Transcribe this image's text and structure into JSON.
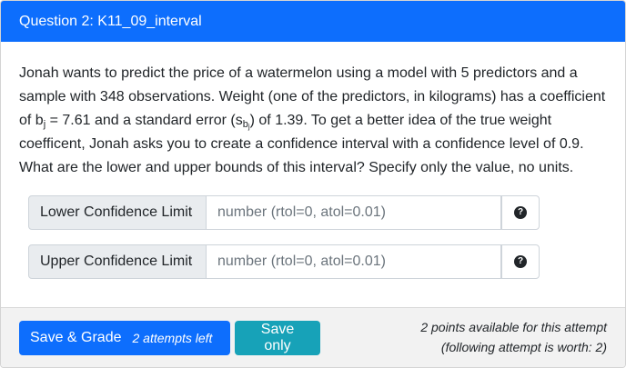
{
  "header": {
    "title": "Question 2: K11_09_interval"
  },
  "question": {
    "part1": "Jonah wants to predict the price of a watermelon using a model with 5 predictors and a sample with 348 observations. Weight (one of the predictors, in kilograms) has a coefficient of b",
    "sub_j": "j",
    "part2": " = 7.61 and a standard error (s",
    "sub_b": "b",
    "subsub_j": "j",
    "part3": ") of 1.39. To get a better idea of the true weight coefficent, Jonah asks you to create a confidence interval with a confidence level of 0.9. What are the lower and upper bounds of this interval? Specify only the value, no units."
  },
  "inputs": [
    {
      "label": "Lower Confidence Limit",
      "placeholder": "number (rtol=0, atol=0.01)",
      "value": ""
    },
    {
      "label": "Upper Confidence Limit",
      "placeholder": "number (rtol=0, atol=0.01)",
      "value": ""
    }
  ],
  "icons": {
    "help": "question-circle-icon"
  },
  "footer": {
    "save_grade_label": "Save & Grade",
    "attempts_left": "2 attempts left",
    "save_only_label": "Save only",
    "points_line1": "2 points available for this attempt",
    "points_line2": "(following attempt is worth: 2)"
  },
  "colors": {
    "primary": "#0d6efd",
    "info": "#17a2b8",
    "header_bg": "#0d6efd"
  }
}
